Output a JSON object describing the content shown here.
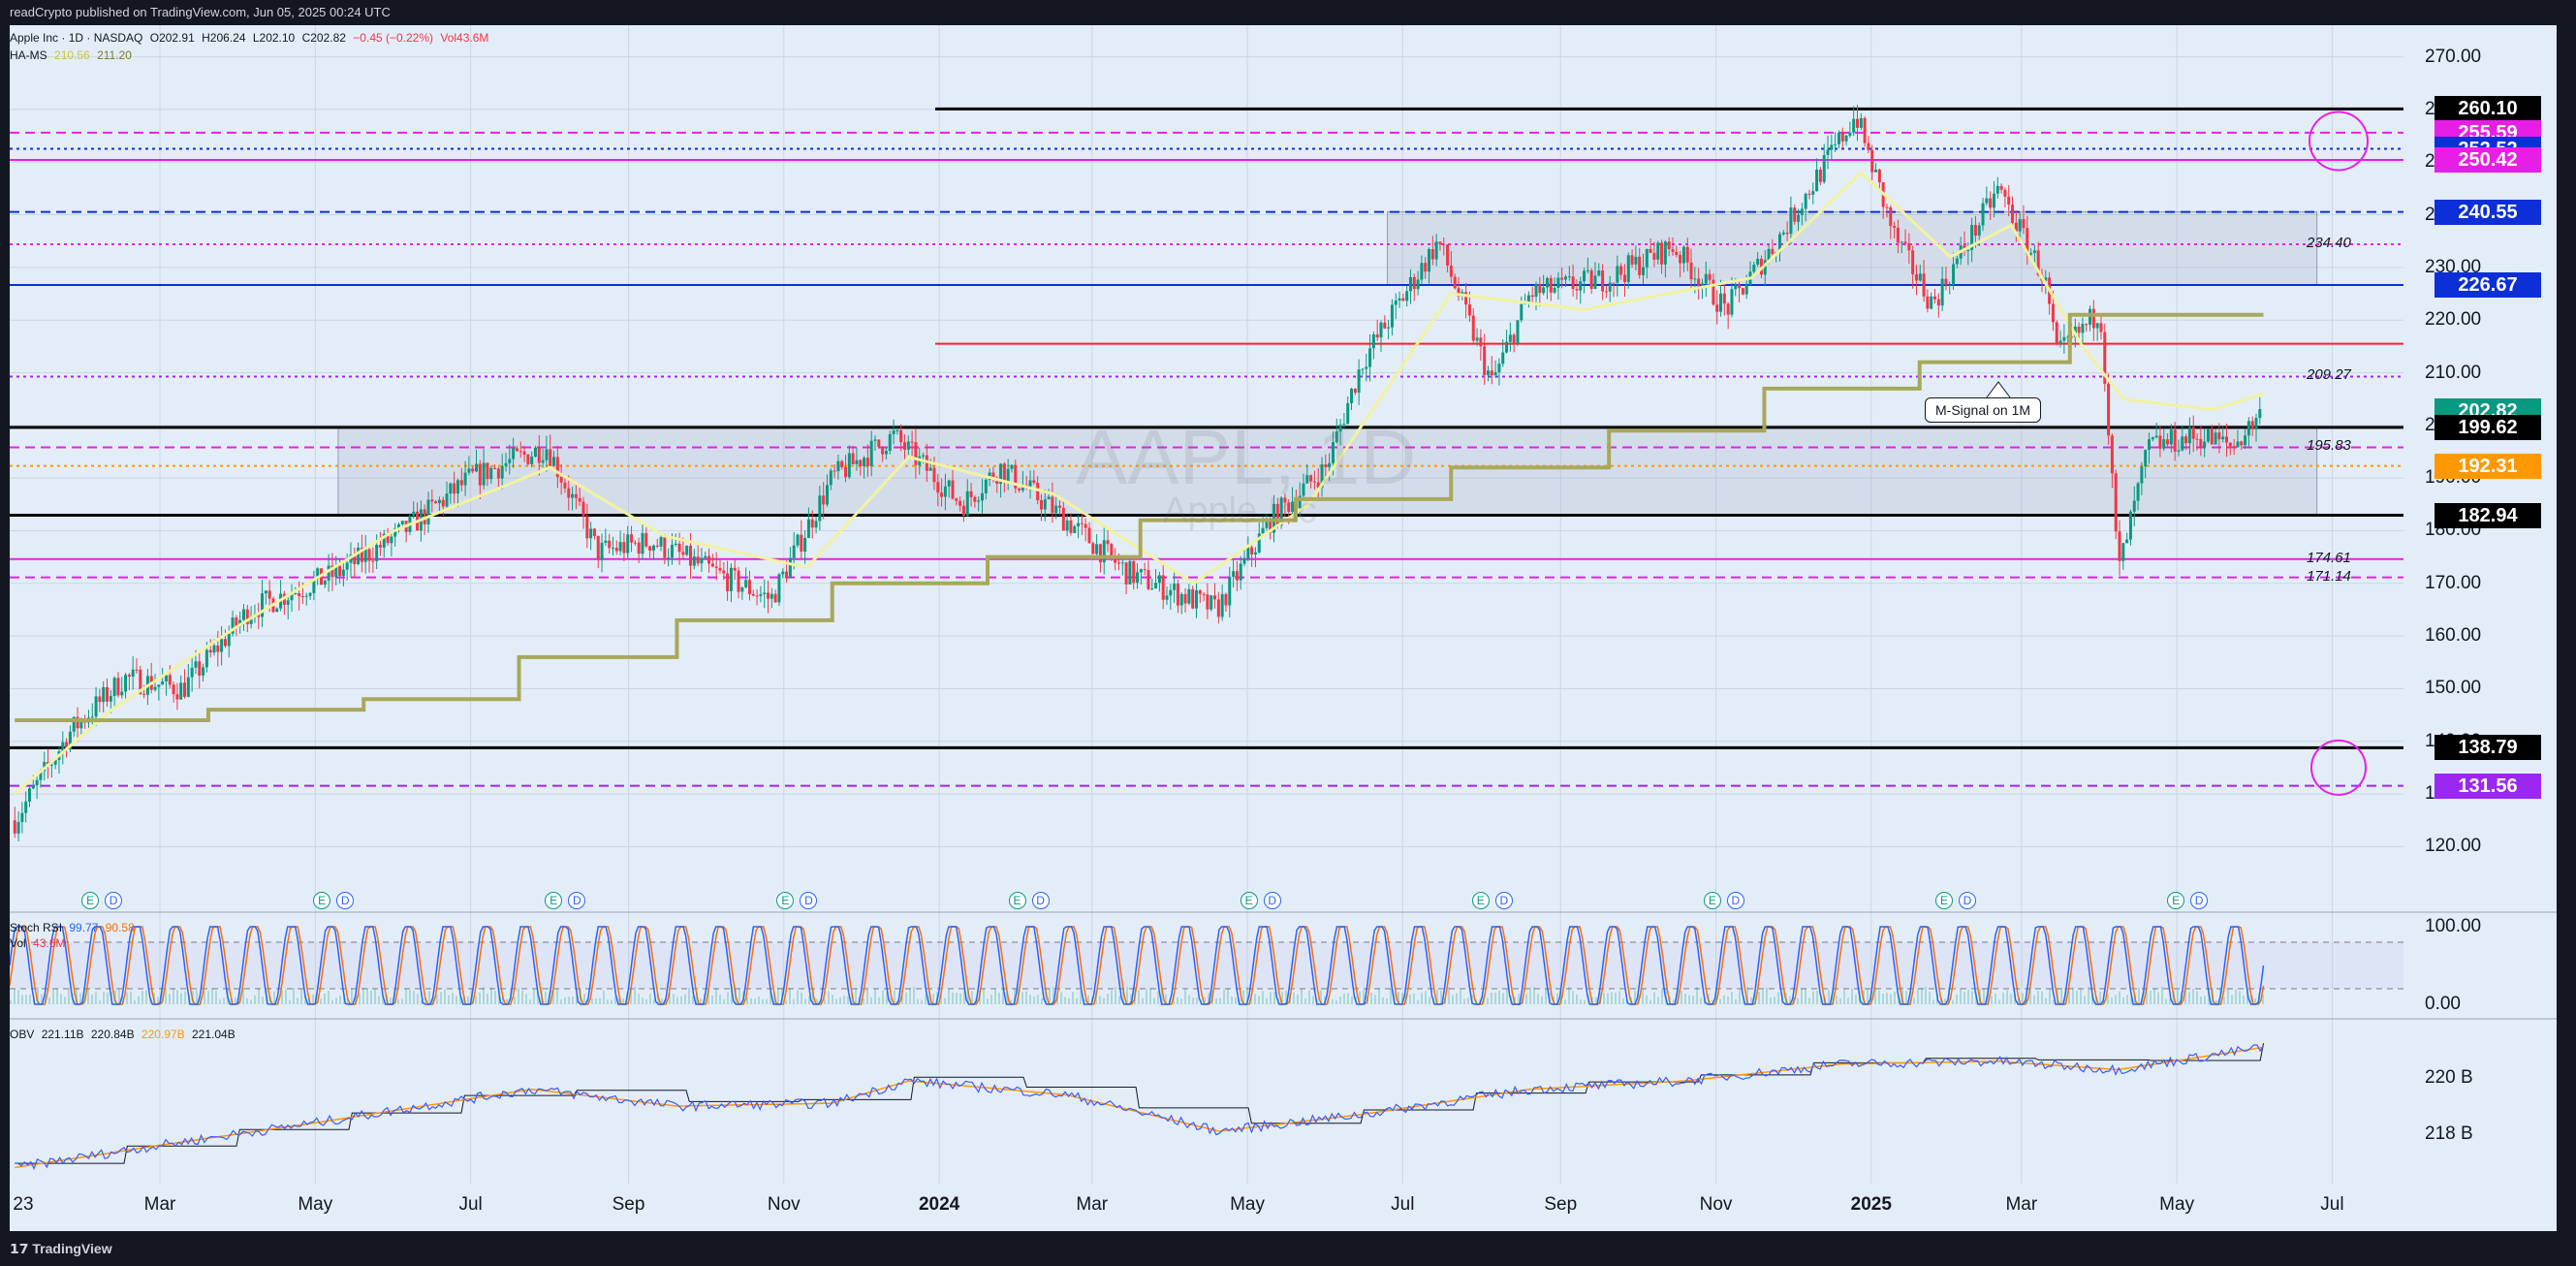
{
  "header": {
    "published": "readCrypto published on TradingView.com, Jun 05, 2025 00:24 UTC"
  },
  "legend": {
    "symbol": "Apple Inc · 1D · NASDAQ",
    "open": "O202.91",
    "high": "H206.24",
    "low": "L202.10",
    "close": "C202.82",
    "change": "−0.45 (−0.22%)",
    "volume": "Vol43.6M",
    "hams_label": "HA-MS",
    "hams_v1": "210.56",
    "hams_v2": "211.20",
    "stoch_label": "Stoch RSI",
    "stoch_k": "99.77",
    "stoch_d": "90.58",
    "vol_label": "Vol",
    "vol_value": "43.6M",
    "obv_label": "OBV",
    "obv_v1": "221.11B",
    "obv_v2": "220.84B",
    "obv_v3": "220.97B",
    "obv_v4": "221.04B"
  },
  "watermark": {
    "ticker": "AAPL, 1D",
    "name": "Apple Inc"
  },
  "annotation": {
    "callout": "M-Signal on 1M"
  },
  "footer": {
    "brand": "TradingView"
  },
  "colors": {
    "bg": "#e3edf8",
    "up": "#089981",
    "down": "#f23645",
    "msignal": "#a8a85a",
    "hams": "#f2f2a0",
    "blue": "#0d2fd8",
    "magenta": "#e91ee6",
    "red": "#ff2020",
    "orange": "#ff9800",
    "purple": "#9c27f0",
    "black": "#000000"
  },
  "chart_data": [
    {
      "type": "candlestick",
      "title": "Apple Inc · 1D · NASDAQ",
      "y_axis_ticks": [
        270,
        260,
        250,
        240,
        230,
        220,
        210,
        200,
        190,
        180,
        170,
        160,
        150,
        140,
        130,
        120
      ],
      "ylim": [
        114,
        276
      ],
      "x_axis_labels": [
        {
          "label": "23",
          "date": "2023-01"
        },
        {
          "label": "Mar",
          "date": "2023-03"
        },
        {
          "label": "May",
          "date": "2023-05"
        },
        {
          "label": "Jul",
          "date": "2023-07"
        },
        {
          "label": "Sep",
          "date": "2023-09"
        },
        {
          "label": "Nov",
          "date": "2023-11"
        },
        {
          "label": "2024",
          "date": "2024-01"
        },
        {
          "label": "Mar",
          "date": "2024-03"
        },
        {
          "label": "May",
          "date": "2024-05"
        },
        {
          "label": "Jul",
          "date": "2024-07"
        },
        {
          "label": "Sep",
          "date": "2024-09"
        },
        {
          "label": "Nov",
          "date": "2024-11"
        },
        {
          "label": "2025",
          "date": "2025-01"
        },
        {
          "label": "Mar",
          "date": "2025-03"
        },
        {
          "label": "May",
          "date": "2025-05"
        },
        {
          "label": "Jul",
          "date": "2025-07"
        }
      ],
      "price_path": [
        [
          "2023-01-03",
          125
        ],
        [
          "2023-01-25",
          142
        ],
        [
          "2023-02-15",
          152
        ],
        [
          "2023-03-10",
          150
        ],
        [
          "2023-04-05",
          165
        ],
        [
          "2023-05-10",
          172
        ],
        [
          "2023-06-05",
          180
        ],
        [
          "2023-07-01",
          190
        ],
        [
          "2023-07-31",
          196
        ],
        [
          "2023-08-20",
          176
        ],
        [
          "2023-09-10",
          178
        ],
        [
          "2023-10-05",
          172
        ],
        [
          "2023-10-27",
          167
        ],
        [
          "2023-11-20",
          190
        ],
        [
          "2023-12-14",
          198
        ],
        [
          "2024-01-10",
          185
        ],
        [
          "2024-01-25",
          192
        ],
        [
          "2024-02-20",
          182
        ],
        [
          "2024-03-15",
          172
        ],
        [
          "2024-04-19",
          165
        ],
        [
          "2024-05-10",
          182
        ],
        [
          "2024-06-01",
          192
        ],
        [
          "2024-06-15",
          212
        ],
        [
          "2024-07-15",
          235
        ],
        [
          "2024-08-05",
          208
        ],
        [
          "2024-08-20",
          225
        ],
        [
          "2024-09-20",
          228
        ],
        [
          "2024-10-15",
          234
        ],
        [
          "2024-11-05",
          222
        ],
        [
          "2024-11-25",
          235
        ],
        [
          "2024-12-26",
          259
        ],
        [
          "2025-01-10",
          236
        ],
        [
          "2025-01-25",
          223
        ],
        [
          "2025-02-20",
          245
        ],
        [
          "2025-03-10",
          228
        ],
        [
          "2025-03-15",
          213
        ],
        [
          "2025-04-01",
          222
        ],
        [
          "2025-04-08",
          172
        ],
        [
          "2025-04-20",
          196
        ],
        [
          "2025-05-10",
          198
        ],
        [
          "2025-05-23",
          196
        ],
        [
          "2025-06-04",
          202.82
        ]
      ],
      "hams_series": [
        [
          "2023-01-03",
          130
        ],
        [
          "2023-02-10",
          146
        ],
        [
          "2023-04-01",
          162
        ],
        [
          "2023-06-01",
          180
        ],
        [
          "2023-08-01",
          192
        ],
        [
          "2023-09-15",
          179
        ],
        [
          "2023-11-10",
          173
        ],
        [
          "2023-12-20",
          194
        ],
        [
          "2024-02-15",
          187
        ],
        [
          "2024-04-10",
          170
        ],
        [
          "2024-05-25",
          185
        ],
        [
          "2024-07-20",
          225
        ],
        [
          "2024-09-10",
          222
        ],
        [
          "2024-11-15",
          228
        ],
        [
          "2024-12-28",
          248
        ],
        [
          "2025-02-01",
          232
        ],
        [
          "2025-02-25",
          238
        ],
        [
          "2025-03-25",
          215
        ],
        [
          "2025-04-10",
          205
        ],
        [
          "2025-05-15",
          203
        ],
        [
          "2025-06-04",
          206
        ]
      ],
      "msignal_steps": [
        [
          "2023-01-03",
          144
        ],
        [
          "2023-03-20",
          146
        ],
        [
          "2023-05-20",
          148
        ],
        [
          "2023-07-20",
          156
        ],
        [
          "2023-09-20",
          163
        ],
        [
          "2023-11-20",
          170
        ],
        [
          "2024-01-20",
          175
        ],
        [
          "2024-03-20",
          182
        ],
        [
          "2024-05-20",
          186
        ],
        [
          "2024-07-20",
          192
        ],
        [
          "2024-09-20",
          199
        ],
        [
          "2024-11-20",
          207
        ],
        [
          "2025-01-20",
          212
        ],
        [
          "2025-03-20",
          221
        ],
        [
          "2025-05-20",
          221
        ],
        [
          "2025-06-04",
          221
        ]
      ],
      "horizontal_levels": [
        {
          "value": 260.1,
          "label": "260.10",
          "style": "solid",
          "color": "#000000"
        },
        {
          "value": 255.59,
          "label": "255.59",
          "style": "dashed",
          "color": "#e91ee6"
        },
        {
          "value": 252.52,
          "label": "252.52",
          "style": "dotted",
          "color": "#0d2fd8"
        },
        {
          "value": 250.42,
          "label": "250.42",
          "style": "solid",
          "color": "#e91ee6"
        },
        {
          "value": 240.55,
          "label": "240.55",
          "style": "dashed",
          "color": "#0d2fd8"
        },
        {
          "value": 234.4,
          "label": "234.40",
          "style": "dotted",
          "color": "#e91ee6"
        },
        {
          "value": 226.67,
          "label": "226.67",
          "style": "solid",
          "color": "#0d2fd8"
        },
        {
          "value": 215.5,
          "label": "",
          "style": "solid",
          "color": "#ff2020"
        },
        {
          "value": 209.27,
          "label": "209.27",
          "style": "dotted",
          "color": "#9c27f0"
        },
        {
          "value": 202.82,
          "label": "202.82",
          "style": "none",
          "color": "#089981"
        },
        {
          "value": 199.62,
          "label": "199.62",
          "style": "solid",
          "color": "#000000"
        },
        {
          "value": 195.83,
          "label": "195.83",
          "style": "dashed",
          "color": "#e91ee6"
        },
        {
          "value": 192.31,
          "label": "192.31",
          "style": "dotted",
          "color": "#ff9800"
        },
        {
          "value": 182.94,
          "label": "182.94",
          "style": "solid",
          "color": "#000000"
        },
        {
          "value": 174.61,
          "label": "174.61",
          "style": "solid",
          "color": "#e91ee6"
        },
        {
          "value": 171.14,
          "label": "171.14",
          "style": "dashed",
          "color": "#e91ee6"
        },
        {
          "value": 138.79,
          "label": "138.79",
          "style": "solid",
          "color": "#000000"
        },
        {
          "value": 131.56,
          "label": "131.56",
          "style": "dashed",
          "color": "#9c27f0"
        }
      ],
      "zones": [
        {
          "from": "2024-06-25",
          "to": "2025-06-25",
          "low": 226.67,
          "high": 240.55
        },
        {
          "from": "2023-05-10",
          "to": "2025-06-25",
          "low": 182.94,
          "high": 199.62
        }
      ],
      "event_markers": [
        "E",
        "D"
      ]
    },
    {
      "type": "line",
      "title": "Stoch RSI",
      "y_axis_ticks": [
        100.0,
        0.0
      ],
      "series": [
        {
          "name": "K",
          "last": 99.77
        },
        {
          "name": "D",
          "last": 90.58
        }
      ],
      "cycles": 58
    },
    {
      "type": "line",
      "title": "OBV",
      "y_axis_ticks": [
        "220 B",
        "218 B"
      ],
      "values_b": [
        [
          "2023-01-03",
          216.8
        ],
        [
          "2023-03-01",
          217.6
        ],
        [
          "2023-05-01",
          218.4
        ],
        [
          "2023-07-25",
          219.6
        ],
        [
          "2023-09-20",
          219.0
        ],
        [
          "2023-11-20",
          219.1
        ],
        [
          "2023-12-20",
          219.9
        ],
        [
          "2024-02-20",
          219.4
        ],
        [
          "2024-04-20",
          218.1
        ],
        [
          "2024-06-15",
          218.7
        ],
        [
          "2024-08-20",
          219.6
        ],
        [
          "2024-10-20",
          219.9
        ],
        [
          "2024-12-20",
          220.5
        ],
        [
          "2025-02-20",
          220.6
        ],
        [
          "2025-04-08",
          220.3
        ],
        [
          "2025-06-04",
          221.1
        ]
      ],
      "ylim": [
        216.4,
        221.6
      ]
    }
  ]
}
